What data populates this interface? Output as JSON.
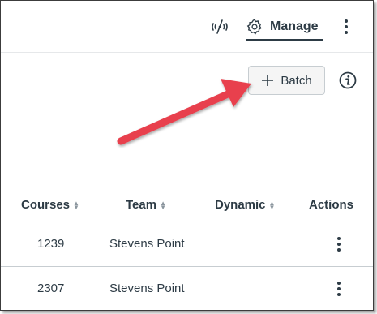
{
  "header": {
    "wifi_icon": "wifi-off-icon",
    "manage_icon": "gear-icon",
    "manage_label": "Manage",
    "more_icon": "vertical-ellipsis-icon"
  },
  "toolbar": {
    "batch_icon": "plus-icon",
    "batch_label": "Batch",
    "info_icon": "info-icon"
  },
  "annotation": {
    "arrow_color": "#e8414d"
  },
  "table": {
    "columns": [
      {
        "label": "Courses",
        "sortable": true
      },
      {
        "label": "Team",
        "sortable": true
      },
      {
        "label": "Dynamic",
        "sortable": true
      },
      {
        "label": "Actions",
        "sortable": false
      }
    ],
    "rows": [
      {
        "courses": "1239",
        "team": "Stevens Point",
        "dynamic": ""
      },
      {
        "courses": "2307",
        "team": "Stevens Point",
        "dynamic": ""
      }
    ]
  },
  "colors": {
    "text": "#2d3b45",
    "button_bg": "#f5f5f5",
    "border": "#c7cdd1"
  }
}
